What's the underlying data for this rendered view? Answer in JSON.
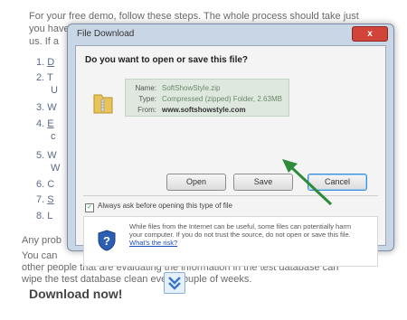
{
  "background": {
    "intro_line1": "For your free demo, follow these steps.  The whole process should take just",
    "intro_line2": "you have",
    "intro_line3": "us. If a",
    "steps": [
      {
        "num": "1.",
        "text": "D"
      },
      {
        "num": "2.",
        "text": "T"
      },
      {
        "num": "",
        "text": "U"
      },
      {
        "num": "3.",
        "text": "W"
      },
      {
        "num": "4.",
        "text": "E"
      },
      {
        "num": "",
        "text": "c"
      },
      {
        "num": "5.",
        "text": "W"
      },
      {
        "num": "",
        "text": "W"
      },
      {
        "num": "6.",
        "text": "C"
      },
      {
        "num": "7.",
        "text": "S"
      },
      {
        "num": "8.",
        "text": "L"
      }
    ],
    "any_prob": "Any prob",
    "you_can": "You can",
    "other_people": "other people that are evaluating the information in the test database can",
    "wipe": "wipe the test database clean every couple of weeks.",
    "download_now": "Download now!"
  },
  "dialog": {
    "title": "File Download",
    "close": "x",
    "question": "Do you want to open or save this file?",
    "name_label": "Name:",
    "name_value": "SoftShowStyle.zip",
    "type_label": "Type:",
    "type_value": "Compressed (zipped) Folder, 2.63MB",
    "from_label": "From:",
    "from_value": "www.softshowstyle.com",
    "open_label": "Open",
    "save_label": "Save",
    "cancel_label": "Cancel",
    "always_ask": "Always ask before opening this type of file",
    "always_ask_checked": true,
    "warning_text": "While files from the Internet can be useful, some files can potentially harm your computer. If you do not trust the source, do not open or save this file.",
    "warning_link": "What's the risk?"
  },
  "colors": {
    "arrow": "#2e8b3a",
    "close": "#d2433a",
    "cancel_border": "#3c8fd8"
  },
  "icons": {
    "file": "zip-file-icon",
    "shield": "security-shield-icon",
    "download": "download-icon"
  }
}
